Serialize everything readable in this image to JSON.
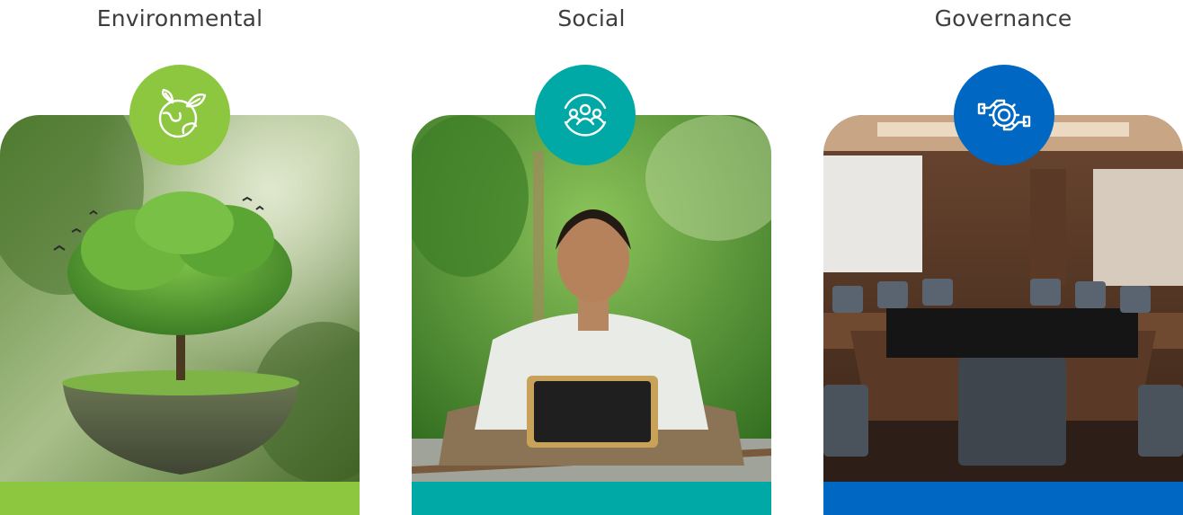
{
  "columns": [
    {
      "title": "Environmental",
      "accent": "#8dc63f",
      "icon": "earth-leaves-icon",
      "image": "tree-on-floating-earth-photo"
    },
    {
      "title": "Social",
      "accent": "#00a9a5",
      "icon": "community-people-icon",
      "image": "boy-with-slate-photo"
    },
    {
      "title": "Governance",
      "accent": "#0068c2",
      "icon": "hands-gear-icon",
      "image": "boardroom-photo"
    }
  ]
}
